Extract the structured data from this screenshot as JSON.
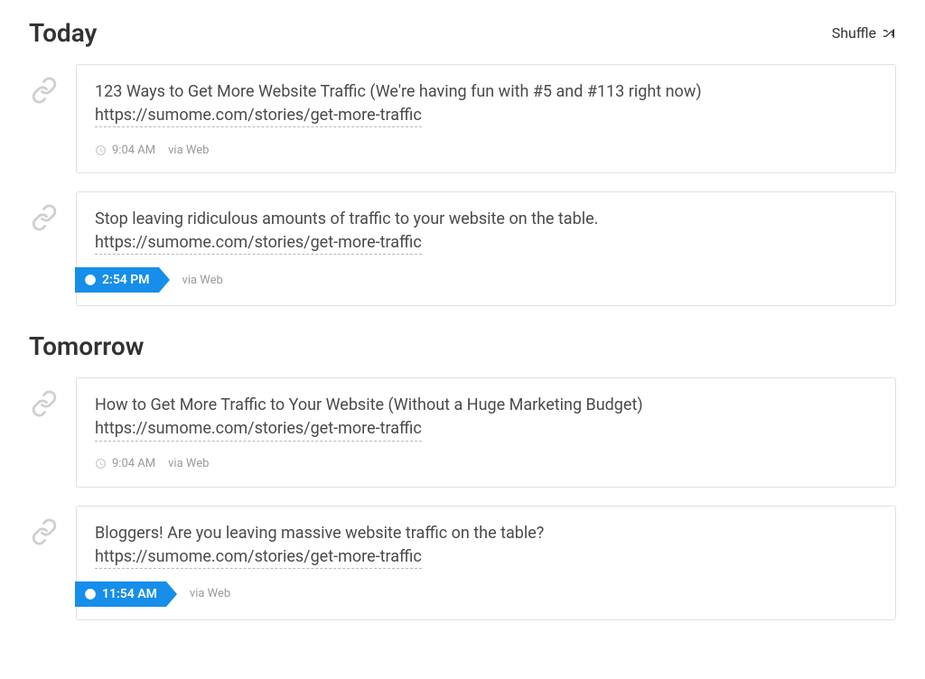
{
  "shuffle_label": "Shuffle",
  "sections": [
    {
      "title": "Today",
      "posts": [
        {
          "text": "123 Ways to Get More Website Traffic (We're having fun with #5 and #113 right now)",
          "url": "https://sumome.com/stories/get-more-traffic",
          "time": "9:04 AM",
          "via": "via Web",
          "highlighted": false
        },
        {
          "text": "Stop leaving ridiculous amounts of traffic to your website on the table.",
          "url": "https://sumome.com/stories/get-more-traffic",
          "time": "2:54 PM",
          "via": "via Web",
          "highlighted": true
        }
      ]
    },
    {
      "title": "Tomorrow",
      "posts": [
        {
          "text": "How to Get More Traffic to Your Website (Without a Huge Marketing Budget)",
          "url": "https://sumome.com/stories/get-more-traffic",
          "time": "9:04 AM",
          "via": "via Web",
          "highlighted": false
        },
        {
          "text": "Bloggers! Are you leaving massive website traffic on the table?",
          "url": "https://sumome.com/stories/get-more-traffic",
          "time": "11:54 AM",
          "via": "via Web",
          "highlighted": true
        }
      ]
    }
  ]
}
